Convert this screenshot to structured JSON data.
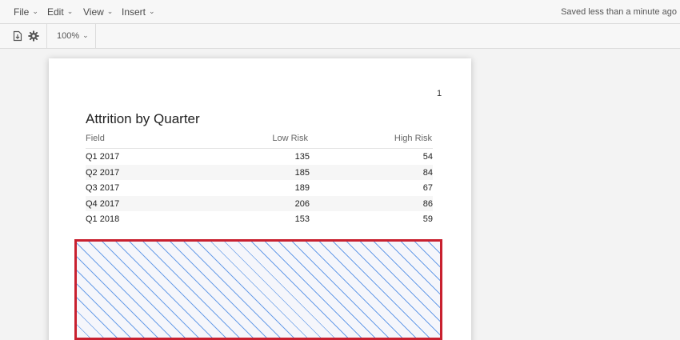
{
  "menubar": {
    "items": [
      {
        "label": "File"
      },
      {
        "label": "Edit"
      },
      {
        "label": "View"
      },
      {
        "label": "Insert"
      }
    ],
    "status": "Saved less than a minute ago"
  },
  "toolbar": {
    "icons": [
      "export-icon",
      "gear-icon"
    ],
    "zoom": "100%"
  },
  "report": {
    "page_number": "1",
    "title": "Attrition by Quarter",
    "columns": [
      "Field",
      "Low Risk",
      "High Risk"
    ],
    "rows": [
      [
        "Q1 2017",
        "135",
        "54"
      ],
      [
        "Q2 2017",
        "185",
        "84"
      ],
      [
        "Q3 2017",
        "189",
        "67"
      ],
      [
        "Q4 2017",
        "206",
        "86"
      ],
      [
        "Q1 2018",
        "153",
        "59"
      ]
    ]
  },
  "colors": {
    "selection_border": "#c8202f",
    "hatch": "#6a9ee8"
  }
}
